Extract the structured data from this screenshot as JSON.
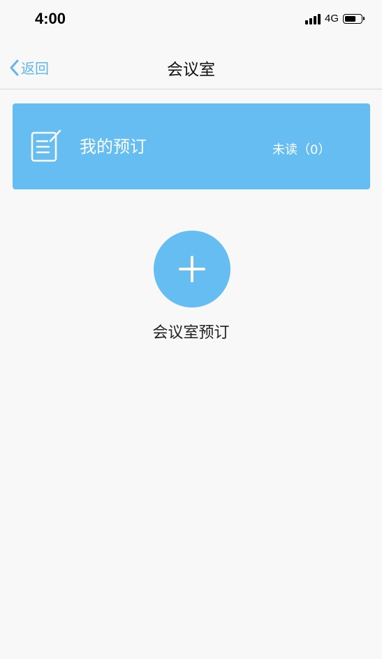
{
  "status_bar": {
    "time": "4:00",
    "network": "4G",
    "battery_level": 0.7
  },
  "nav": {
    "back_label": "返回",
    "title": "会议室"
  },
  "booking_card": {
    "icon": "edit-note-icon",
    "title": "我的预订",
    "unread": "未读（0）"
  },
  "add_action": {
    "icon": "plus-icon",
    "label": "会议室预订"
  },
  "colors": {
    "accent": "#66bdf1",
    "link": "#5fb6ec"
  }
}
